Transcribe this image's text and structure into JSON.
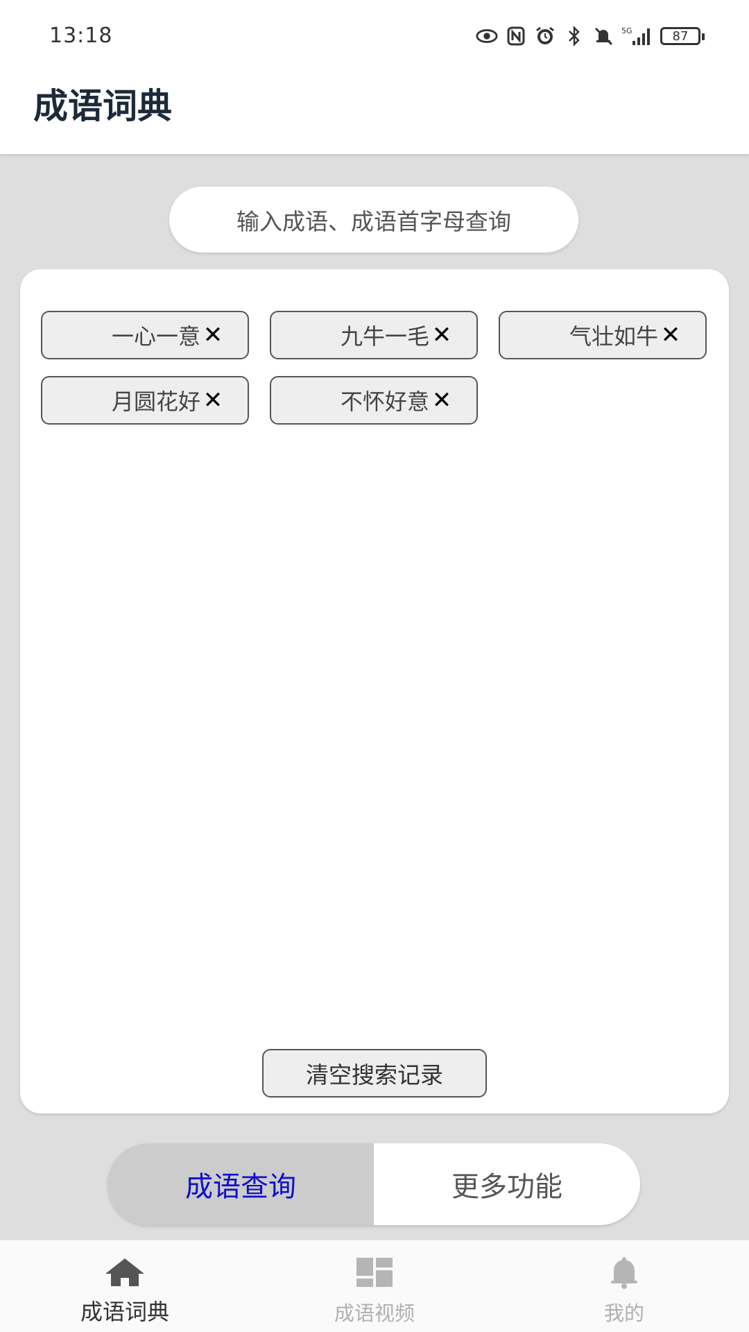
{
  "status_bar": {
    "time": "13:18",
    "icons": [
      "eye-icon",
      "nfc-icon",
      "alarm-icon",
      "bluetooth-icon",
      "mute-icon",
      "signal-5g-icon"
    ],
    "battery": "87"
  },
  "header": {
    "title": "成语词典"
  },
  "search": {
    "placeholder": "输入成语、成语首字母查询"
  },
  "history": {
    "items": [
      {
        "label": "一心一意",
        "icon": "close-icon"
      },
      {
        "label": "九牛一毛",
        "icon": "close-icon"
      },
      {
        "label": "气壮如牛",
        "icon": "close-icon"
      },
      {
        "label": "月圆花好",
        "icon": "close-icon"
      },
      {
        "label": "不怀好意",
        "icon": "close-icon"
      }
    ],
    "close_glyph": "✕",
    "clear_label": "清空搜索记录"
  },
  "segment": {
    "tabs": [
      {
        "label": "成语查询",
        "selected": true
      },
      {
        "label": "更多功能",
        "selected": false
      }
    ],
    "active_color": "#1010c8"
  },
  "bottom_nav": {
    "items": [
      {
        "label": "成语词典",
        "icon": "home-icon",
        "active": true
      },
      {
        "label": "成语视频",
        "icon": "dashboard-icon",
        "active": false
      },
      {
        "label": "我的",
        "icon": "bell-icon",
        "active": false
      }
    ]
  }
}
